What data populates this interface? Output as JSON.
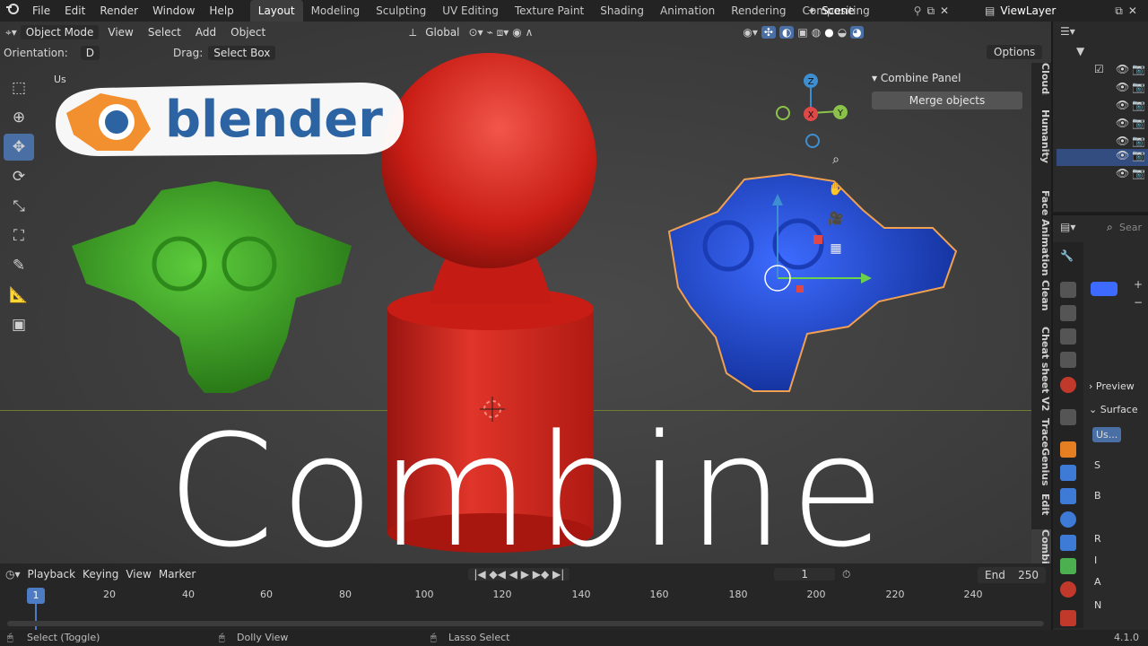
{
  "topbar": {
    "menu": [
      "File",
      "Edit",
      "Render",
      "Window",
      "Help"
    ],
    "workspaces": [
      "Layout",
      "Modeling",
      "Sculpting",
      "UV Editing",
      "Texture Paint",
      "Shading",
      "Animation",
      "Rendering",
      "Compositing"
    ],
    "active_workspace": "Layout",
    "scene": "Scene",
    "view_layer": "ViewLayer"
  },
  "viewport": {
    "mode": "Object Mode",
    "menus": [
      "View",
      "Select",
      "Add",
      "Object"
    ],
    "transform_orientation": "Global",
    "orientation_label": "Orientation:",
    "drag_label": "Drag:",
    "drag_value": "Select Box",
    "options": "Options",
    "view_label": "Us",
    "gizmo": {
      "z": "Z",
      "x": "X",
      "y": "Y"
    },
    "colors": {
      "x_axis": "#e04848",
      "y_axis": "#8bc34a",
      "z_axis": "#3d8fd1",
      "floor_line": "#6f7d33"
    }
  },
  "combine_panel": {
    "title": "Combine Panel",
    "merge_button": "Merge objects"
  },
  "side_tabs": [
    "Clouds",
    "Humanity",
    "Face Animation",
    "Clean",
    "Cheat sheet V2",
    "TraceGenius",
    "Edit",
    "Combine"
  ],
  "logo": {
    "text": "blender"
  },
  "overlay_title": "Combine",
  "timeline": {
    "menus": [
      "Playback",
      "Keying",
      "View",
      "Marker"
    ],
    "current_frame": "1",
    "end_label": "End",
    "end_value": "250",
    "ticks": [
      "20",
      "40",
      "60",
      "80",
      "100",
      "120",
      "140",
      "160",
      "180",
      "200",
      "220",
      "240"
    ]
  },
  "statusbar": {
    "left": "Select (Toggle)",
    "middle": "Dolly View",
    "right": "Lasso Select",
    "version": "4.1.0"
  },
  "properties": {
    "search_placeholder": "Sear",
    "preview": "Preview",
    "surface": "Surface",
    "use_nodes": "Us...",
    "rows": [
      "S",
      "B",
      "R",
      "I",
      "A",
      "N"
    ]
  },
  "objects": {
    "monkey_left_color": "#3fa52a",
    "pawn_color": "#d8231a",
    "monkey_right_color": "#1f48c9"
  }
}
